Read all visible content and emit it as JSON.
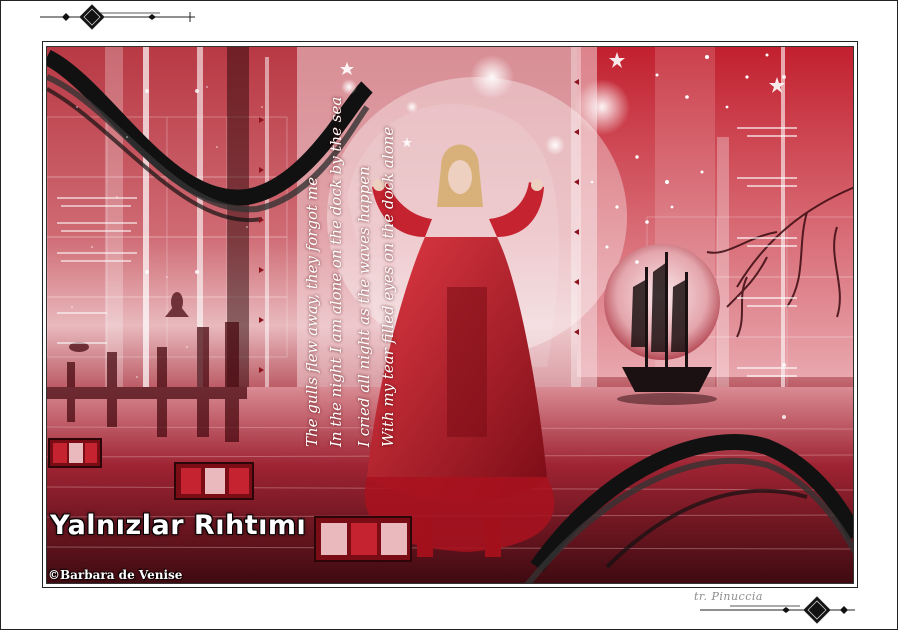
{
  "artwork": {
    "title": "Yalnızlar Rıhtımı",
    "poem_lines": [
      "The gulls flew away, they forgot me",
      "In the night I am alone on the dock by the sea",
      "I cried all night as the waves happen",
      "With my tear filled eyes on the dock alone"
    ],
    "copyright": "©Barbara de Venise",
    "credit": "tr. Pinuccia"
  },
  "colors": {
    "primary_red": "#b8202e",
    "deep_red": "#611019",
    "light_pink": "#e8b9bd",
    "black_swoosh": "#111111"
  }
}
